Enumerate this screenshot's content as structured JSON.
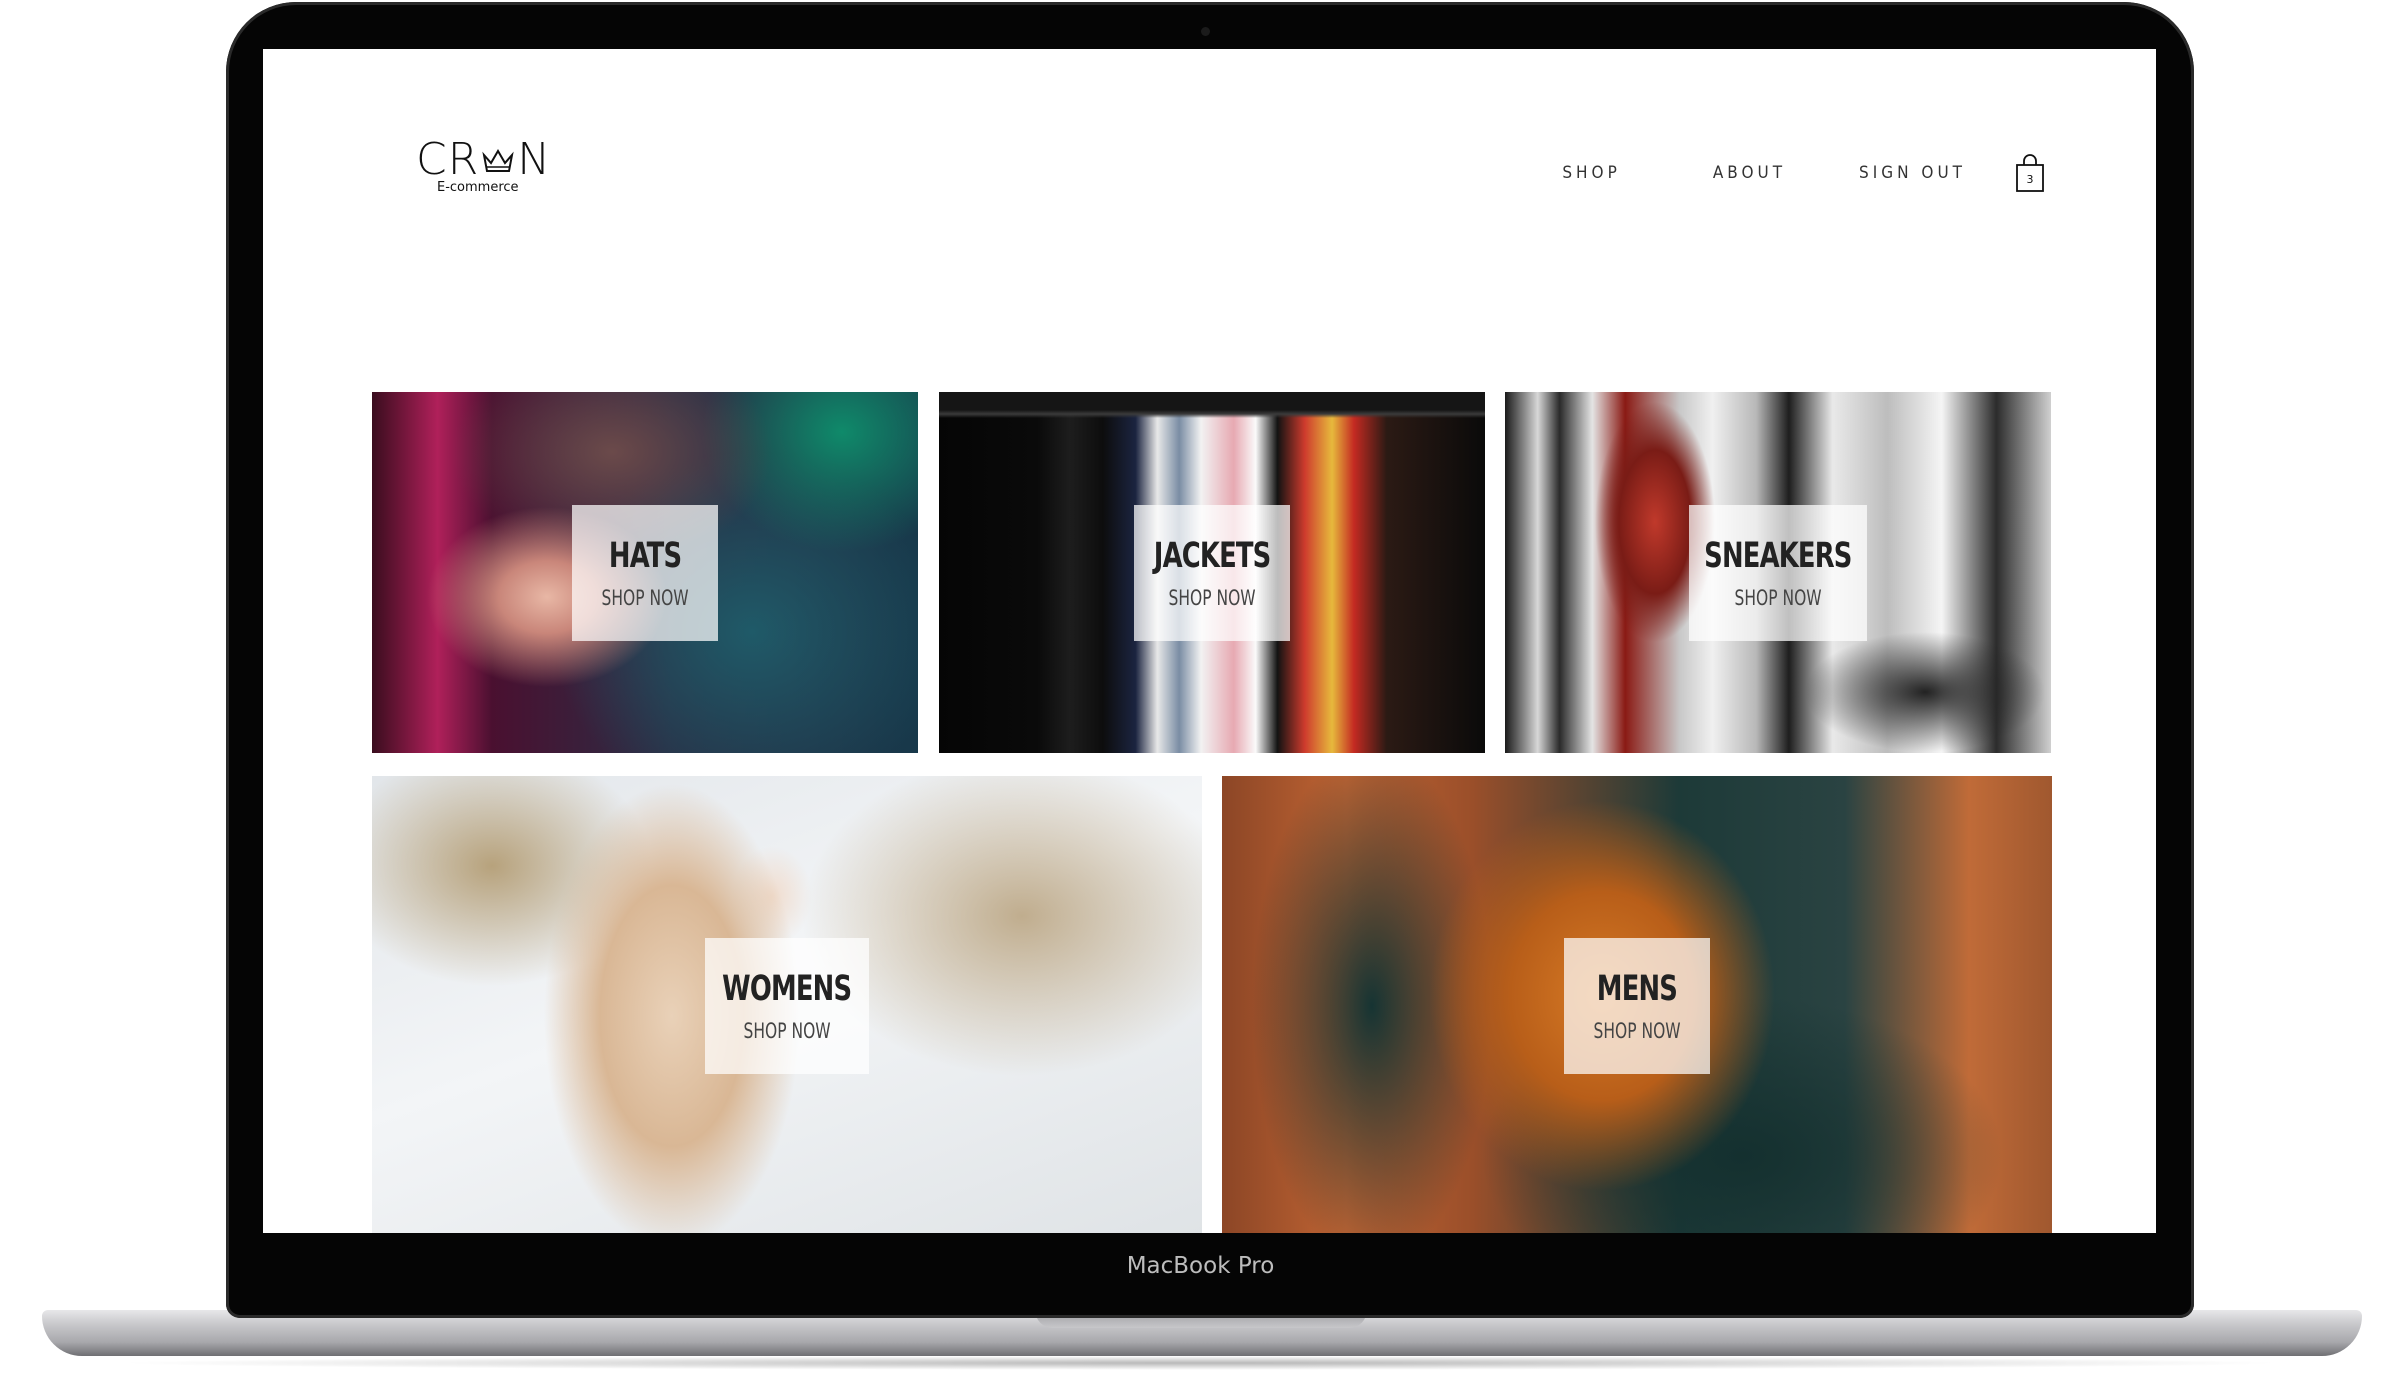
{
  "device": {
    "model_label": "MacBook Pro"
  },
  "brand": {
    "logo_text": "CR N",
    "logo_left": "CR",
    "logo_right": "N",
    "subtitle": "E-commerce"
  },
  "nav": {
    "items": [
      {
        "label": "SHOP"
      },
      {
        "label": "ABOUT"
      },
      {
        "label": "SIGN OUT"
      }
    ],
    "cart": {
      "icon": "shopping-bag-icon",
      "count": "3"
    }
  },
  "categories": [
    {
      "title": "HATS",
      "cta": "SHOP NOW"
    },
    {
      "title": "JACKETS",
      "cta": "SHOP NOW"
    },
    {
      "title": "SNEAKERS",
      "cta": "SHOP NOW"
    },
    {
      "title": "WOMENS",
      "cta": "SHOP NOW"
    },
    {
      "title": "MENS",
      "cta": "SHOP NOW"
    }
  ],
  "colors": {
    "text": "#333333",
    "label_bg": "rgba(255,255,255,0.72)",
    "frame": "#050505"
  }
}
